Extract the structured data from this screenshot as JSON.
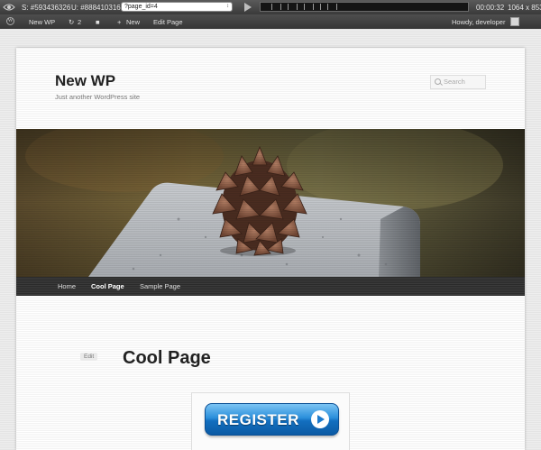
{
  "recorder": {
    "session_label": "S: #593436326",
    "user_label": "U: #888410316",
    "url_value": "?page_id=4",
    "elapsed": "00:00:32",
    "dimensions": "1064 x 853"
  },
  "adminbar": {
    "site_name": "New WP",
    "updates_count": "2",
    "new_label": "New",
    "edit_label": "Edit Page",
    "greeting": "Howdy, developer"
  },
  "site": {
    "title": "New WP",
    "description": "Just another WordPress site",
    "search_placeholder": "Search"
  },
  "nav": {
    "items": [
      {
        "label": "Home"
      },
      {
        "label": "Cool Page"
      },
      {
        "label": "Sample Page"
      }
    ],
    "current_index": 1
  },
  "content": {
    "edit_label": "Edit",
    "title": "Cool Page",
    "register_label": "REGISTER"
  },
  "colors": {
    "nav_bar": "#333333",
    "register_blue": "#1d7acc"
  }
}
